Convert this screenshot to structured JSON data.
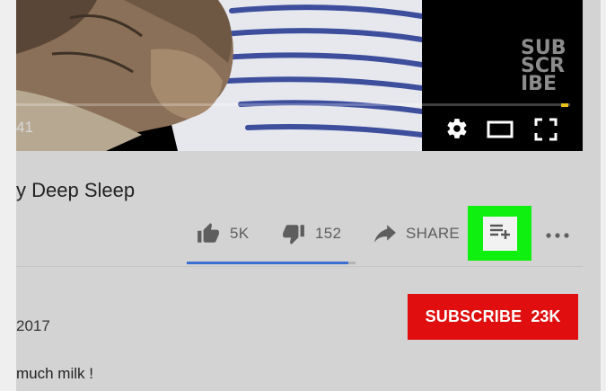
{
  "video": {
    "watermark_lines": [
      "SUB",
      "SCR",
      "IBE"
    ],
    "time_fragment": "41",
    "controls": {
      "settings_icon": "gear-icon",
      "theater_icon": "theater-mode-icon",
      "fullscreen_icon": "fullscreen-icon"
    },
    "progress_marker_color": "#e9c21a"
  },
  "title": "y Deep Sleep",
  "actions": {
    "like_count": "5K",
    "dislike_count": "152",
    "share_label": "SHARE",
    "save_highlight_color": "#10f010",
    "like_ratio": 0.96
  },
  "channel": {
    "date_fragment": "2017",
    "subscribe_label": "SUBSCRIBE",
    "subscriber_count": "23K",
    "subscribe_color": "#e00e0e"
  },
  "description_fragment": "much milk !"
}
